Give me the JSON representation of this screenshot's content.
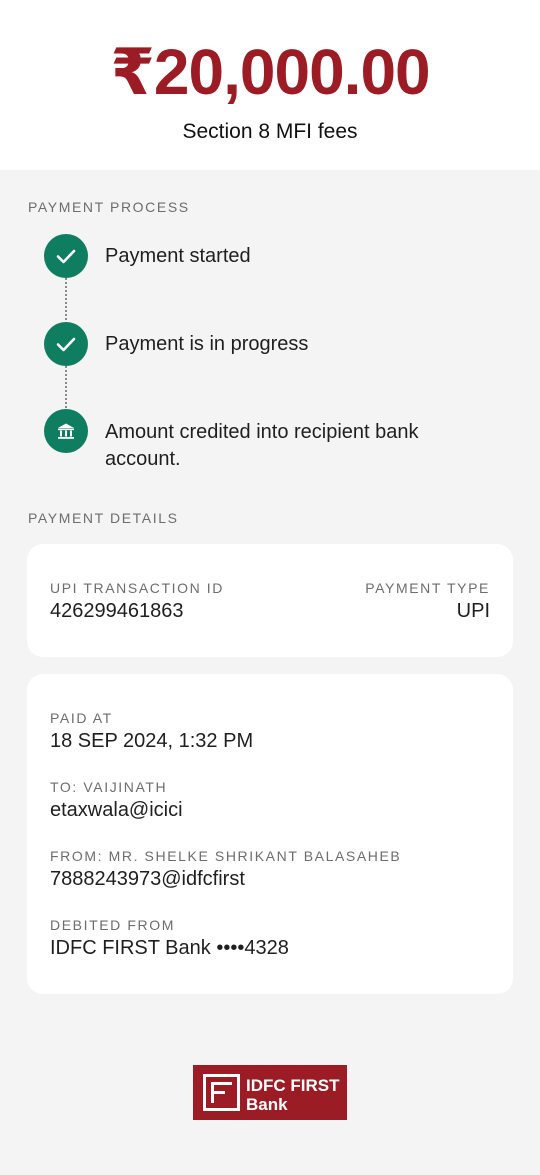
{
  "header": {
    "amount": "₹20,000.00",
    "purpose": "Section 8 MFI fees"
  },
  "process": {
    "title": "PAYMENT PROCESS",
    "steps": [
      {
        "label": "Payment started",
        "icon": "check-icon",
        "status": "completed"
      },
      {
        "label": "Payment is in progress",
        "icon": "check-icon",
        "status": "completed"
      },
      {
        "label": "Amount credited into recipient bank account.",
        "icon": "bank-icon",
        "status": "current"
      }
    ]
  },
  "details": {
    "title": "PAYMENT DETAILS",
    "txn_id_label": "UPI TRANSACTION ID",
    "txn_id": "426299461863",
    "type_label": "PAYMENT TYPE",
    "type": "UPI",
    "paid_at_label": "PAID AT",
    "paid_at": "18 SEP 2024, 1:32 PM",
    "to_label": "TO: VAIJINATH",
    "to": "etaxwala@icici",
    "from_label": "FROM: MR. SHELKE SHRIKANT BALASAHEB",
    "from": "7888243973@idfcfirst",
    "debited_label": "DEBITED FROM",
    "debited": "IDFC FIRST Bank ••••4328"
  },
  "brand": {
    "line1": "IDFC FIRST",
    "line2": "Bank",
    "color": "#9b1c24",
    "accent": "#0f7d60"
  }
}
